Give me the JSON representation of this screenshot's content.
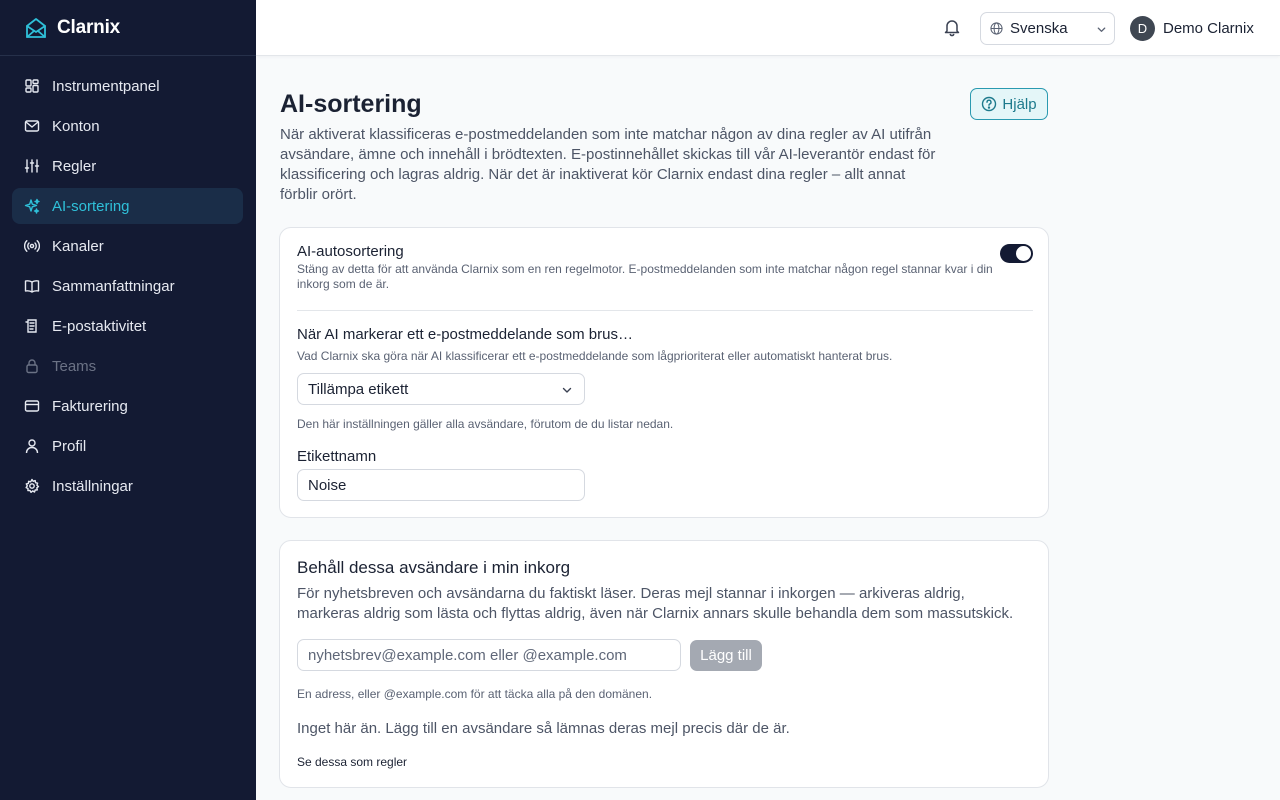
{
  "brand": {
    "name": "Clarnix"
  },
  "sidebar": {
    "items": [
      {
        "label": "Instrumentpanel",
        "icon": "dashboard-icon"
      },
      {
        "label": "Konton",
        "icon": "mail-icon"
      },
      {
        "label": "Regler",
        "icon": "sliders-icon"
      },
      {
        "label": "AI-sortering",
        "icon": "sparkles-icon",
        "active": true
      },
      {
        "label": "Kanaler",
        "icon": "broadcast-icon"
      },
      {
        "label": "Sammanfattningar",
        "icon": "book-icon"
      },
      {
        "label": "E-postaktivitet",
        "icon": "activity-log-icon"
      },
      {
        "label": "Teams",
        "icon": "lock-icon",
        "disabled": true
      },
      {
        "label": "Fakturering",
        "icon": "credit-card-icon"
      },
      {
        "label": "Profil",
        "icon": "user-icon"
      },
      {
        "label": "Inställningar",
        "icon": "gear-icon"
      }
    ]
  },
  "header": {
    "language": "Svenska",
    "user_initial": "D",
    "user_name": "Demo Clarnix"
  },
  "main": {
    "title": "AI-sortering",
    "help_label": "Hjälp",
    "intro": "När aktiverat klassificeras e-postmeddelanden som inte matchar någon av dina regler av AI utifrån avsändare, ämne och innehåll i brödtexten. E-postinnehållet skickas till vår AI-leverantör endast för klassificering och lagras aldrig. När det är inaktiverat kör Clarnix endast dina regler – allt annat förblir orört.",
    "auto": {
      "title": "AI-autosortering",
      "description": "Stäng av detta för att använda Clarnix som en ren regelmotor. E-postmeddelanden som inte matchar någon regel stannar kvar i din inkorg som de är.",
      "enabled": true
    },
    "noise": {
      "title": "När AI markerar ett e-postmeddelande som brus…",
      "description": "Vad Clarnix ska göra när AI klassificerar ett e-postmeddelande som lågprioriterat eller automatiskt hanterat brus.",
      "action": "Tillämpa etikett",
      "note": "Den här inställningen gäller alla avsändare, förutom de du listar nedan.",
      "label_title": "Etikettnamn",
      "label_value": "Noise"
    },
    "keep": {
      "title": "Behåll dessa avsändare i min inkorg",
      "description": "För nyhetsbreven och avsändarna du faktiskt läser. Deras mejl stannar i inkorgen — arkiveras aldrig, markeras aldrig som lästa och flyttas aldrig, även när Clarnix annars skulle behandla dem som massutskick.",
      "placeholder": "nyhetsbrev@example.com eller @example.com",
      "add_label": "Lägg till",
      "input_note": "En adress, eller @example.com för att täcka alla på den domänen.",
      "empty": "Inget här än. Lägg till en avsändare så lämnas deras mejl precis där de är.",
      "rules_link": "Se dessa som regler"
    }
  },
  "colors": {
    "sidebar_bg": "#131a33",
    "accent": "#2fc0d9",
    "toggle_on": "#131a33"
  }
}
